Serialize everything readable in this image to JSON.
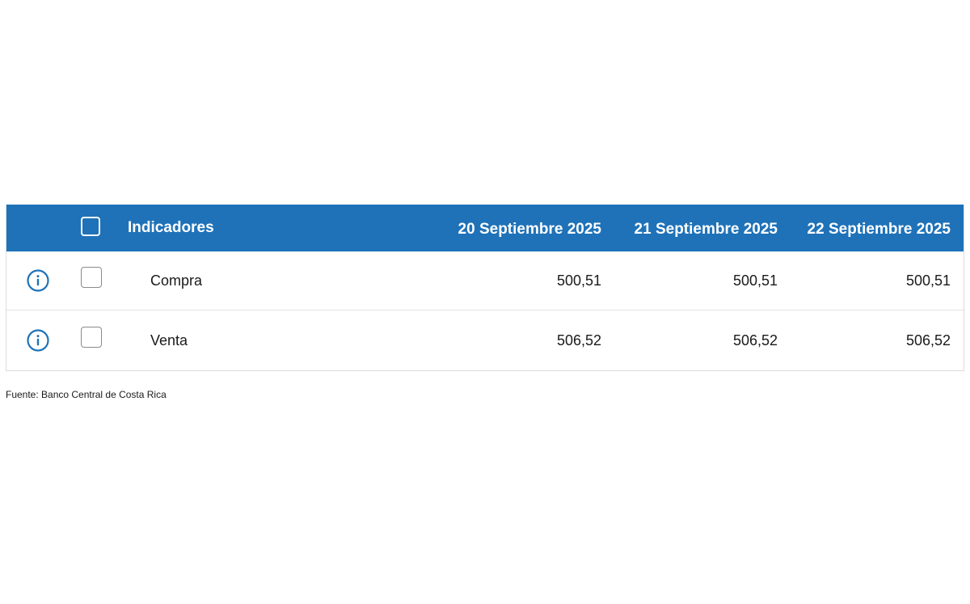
{
  "table": {
    "header": {
      "indicator_label": "Indicadores",
      "dates": [
        "20 Septiembre 2025",
        "21 Septiembre 2025",
        "22 Septiembre 2025"
      ]
    },
    "rows": [
      {
        "name": "Compra",
        "values": [
          "500,51",
          "500,51",
          "500,51"
        ]
      },
      {
        "name": "Venta",
        "values": [
          "506,52",
          "506,52",
          "506,52"
        ]
      }
    ]
  },
  "footer": {
    "source": "Fuente: Banco Central de Costa Rica"
  },
  "colors": {
    "header_bg": "#1f72b8",
    "info_icon": "#1f72b8"
  },
  "icons": {
    "row_info": "info-circle-icon"
  }
}
